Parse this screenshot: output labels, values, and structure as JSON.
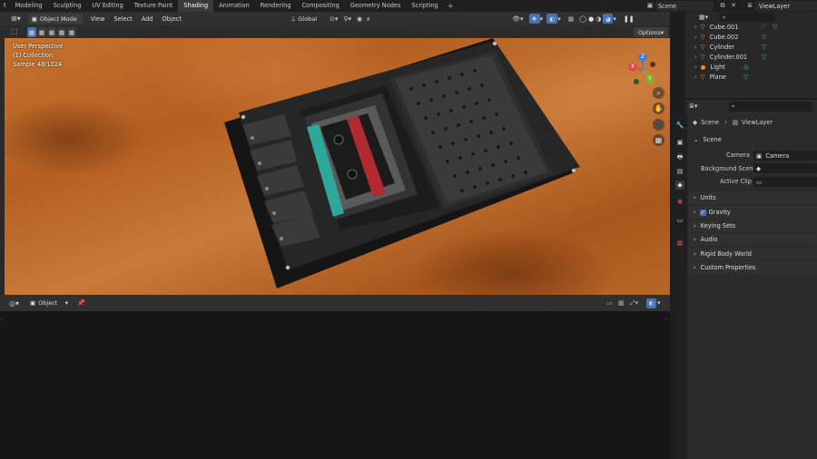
{
  "topbar": {
    "tabs": [
      "t",
      "Modeling",
      "Sculpting",
      "UV Editing",
      "Texture Paint",
      "Shading",
      "Animation",
      "Rendering",
      "Compositing",
      "Geometry Nodes",
      "Scripting"
    ],
    "active_tab": "Shading",
    "add_tab": "+",
    "scene": "Scene",
    "view_layer": "ViewLayer"
  },
  "viewport_header": {
    "mode": "Object Mode",
    "menus": [
      "View",
      "Select",
      "Add",
      "Object"
    ],
    "orientation": "Global",
    "options": "Options"
  },
  "overlay": {
    "perspective": "User Perspective",
    "collection": "(1) Collection",
    "sample": "Sample 48/1024"
  },
  "gizmo": {
    "x": "X",
    "y": "Y",
    "z": "Z"
  },
  "bottom_editor": {
    "object": "Object"
  },
  "outliner": {
    "items": [
      {
        "name": "Cube.001",
        "icon": "mesh-triangle"
      },
      {
        "name": "Cube.002",
        "icon": "mesh-triangle"
      },
      {
        "name": "Cylinder",
        "icon": "mesh-triangle"
      },
      {
        "name": "Cylinder.001",
        "icon": "mesh-triangle"
      },
      {
        "name": "Light",
        "icon": "bulb"
      },
      {
        "name": "Plane",
        "icon": "mesh-triangle"
      }
    ]
  },
  "properties": {
    "breadcrumb_scene": "Scene",
    "breadcrumb_layer": "ViewLayer",
    "scene_panel": "Scene",
    "camera_label": "Camera",
    "camera_value": "Camera",
    "background_label": "Background Scene",
    "active_clip_label": "Active Clip",
    "panels": [
      "Units",
      "Gravity",
      "Keying Sets",
      "Audio",
      "Rigid Body World",
      "Custom Properties"
    ]
  },
  "colors": {
    "accent": "#4772b3",
    "object_orange": "#e88a2e",
    "mesh_green": "#4ec26a"
  }
}
